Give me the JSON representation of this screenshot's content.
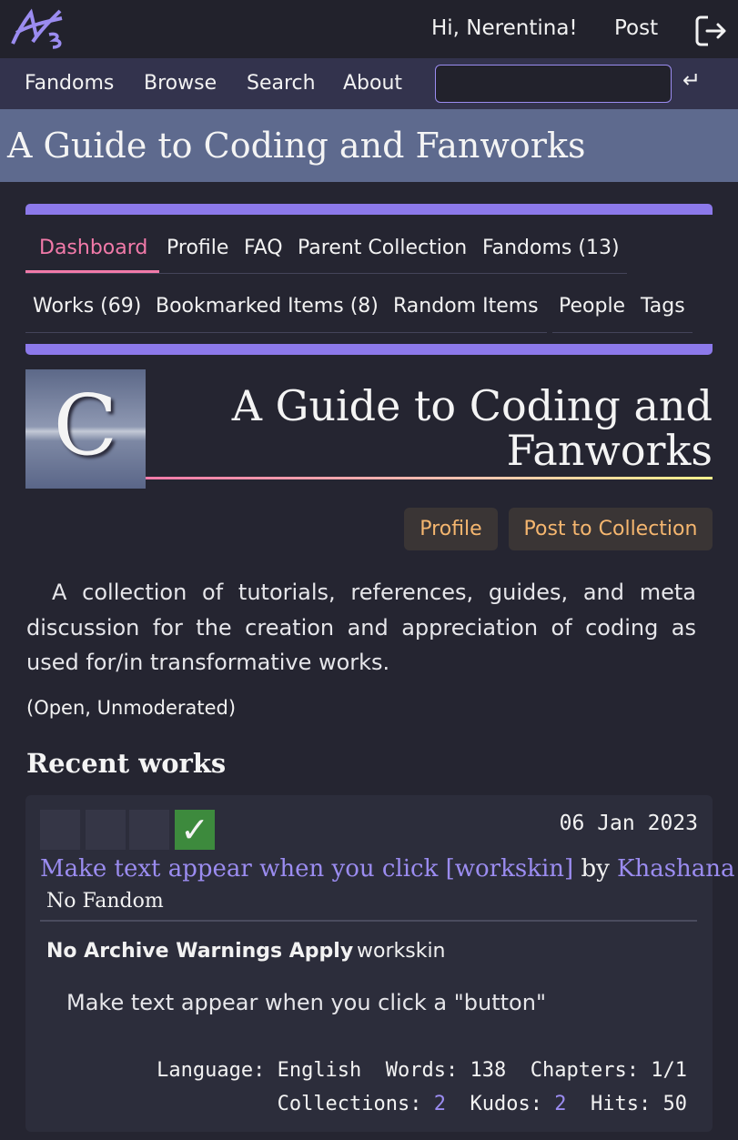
{
  "header": {
    "logo_icon": "ao3-logo-icon",
    "greeting": "Hi, Nerentina!",
    "post_label": "Post",
    "logout_icon": "logout-icon"
  },
  "nav": {
    "items": [
      "Fandoms",
      "Browse",
      "Search",
      "About"
    ],
    "search_value": "",
    "enter_icon": "↵"
  },
  "banner": {
    "title": "A Guide to Coding and Fanworks"
  },
  "subnav": {
    "row1": [
      "Dashboard",
      "Profile",
      "FAQ",
      "Parent Collection",
      "Fandoms (13)"
    ],
    "row2": [
      "Works (69)",
      "Bookmarked Items (8)",
      "Random Items",
      "People",
      "Tags"
    ],
    "active": "Dashboard"
  },
  "collection": {
    "icon_letter": "C",
    "title": "A Guide to Coding and Fanworks",
    "buttons": {
      "profile": "Profile",
      "post": "Post to Collection"
    },
    "description": "A collection of tutorials, references, guides, and meta discussion for the creation and appreciation of coding as used for/in transformative works.",
    "status": "(Open, Unmoderated)"
  },
  "recent": {
    "heading": "Recent works",
    "works": [
      {
        "date": "06 Jan 2023",
        "title": "Make text appear when you click [workskin]",
        "by": "by",
        "author": "Khashana",
        "fandom": "No Fandom",
        "warning": "No Archive Warnings Apply",
        "tag": "workskin",
        "summary": "Make text appear when you click a \"button\"",
        "check_glyph": "✓",
        "stats": {
          "language_label": "Language:",
          "language": "English",
          "words_label": "Words:",
          "words": "138",
          "chapters_label": "Chapters:",
          "chapters": "1/1",
          "collections_label": "Collections:",
          "collections": "2",
          "kudos_label": "Kudos:",
          "kudos": "2",
          "hits_label": "Hits:",
          "hits": "50"
        }
      }
    ]
  },
  "colors": {
    "accent": "#8c79ea",
    "link": "#9b8cf0",
    "active_tab": "#f27aa9",
    "button_text": "#f5b66f",
    "banner": "#5e6a8e"
  }
}
